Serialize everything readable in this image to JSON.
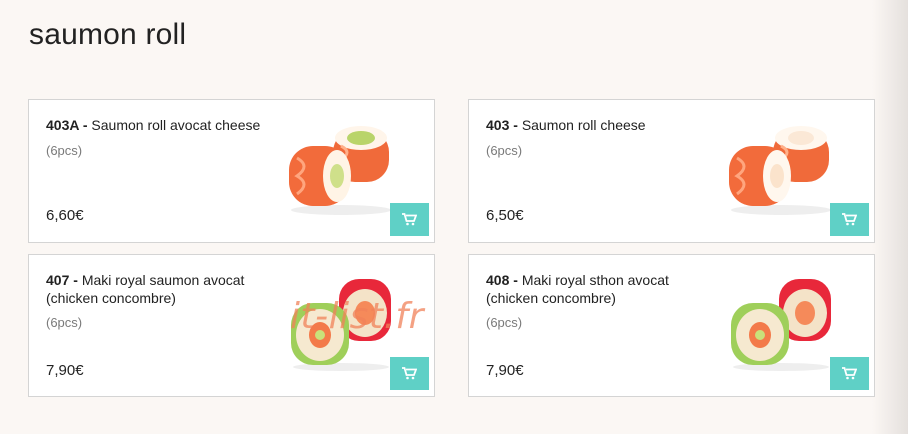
{
  "section": {
    "title": "saumon roll"
  },
  "products": [
    {
      "code": "403A -",
      "name": "Saumon roll avocat cheese",
      "pieces": "(6pcs)",
      "price": "6,60€",
      "image_icon": "salmon-roll-avocado-icon"
    },
    {
      "code": "403 -",
      "name": "Saumon roll cheese",
      "pieces": "(6pcs)",
      "price": "6,50€",
      "image_icon": "salmon-roll-cheese-icon"
    },
    {
      "code": "407 -",
      "name": "Maki royal saumon avocat (chicken concombre)",
      "pieces": "(6pcs)",
      "price": "7,90€",
      "image_icon": "maki-royal-icon"
    },
    {
      "code": "408 -",
      "name": "Maki royal sthon avocat (chicken concombre)",
      "pieces": "(6pcs)",
      "price": "7,90€",
      "image_icon": "maki-royal-icon"
    }
  ],
  "cart_button_icon": "shopping-cart-icon",
  "watermark": "it-list.fr",
  "colors": {
    "cart_button": "#5fd0c6",
    "background": "#fbf7f4",
    "card_border": "#d4d4d4"
  }
}
